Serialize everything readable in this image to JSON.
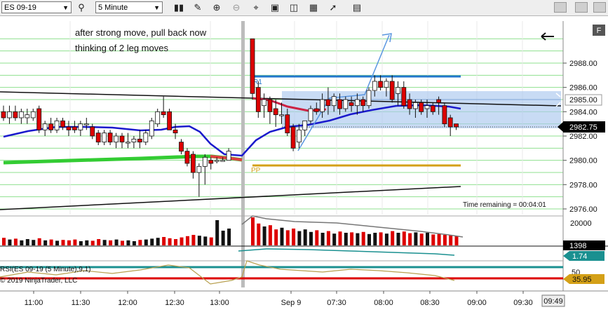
{
  "toolbar": {
    "instrument": "ES 09-19",
    "interval": "5 Minute",
    "icons": [
      "search-icon",
      "bar-style-icon",
      "pencil-icon",
      "zoom-in-icon",
      "zoom-out-icon",
      "crosshair-icon",
      "data-box-icon",
      "properties-icon",
      "strategy-icon",
      "indicators-icon",
      "template-icon"
    ]
  },
  "annotations": {
    "line1": "after strong move, pull back now",
    "line2": "thinking of 2 leg moves"
  },
  "f_button": "F",
  "time_remaining": "Time remaining = 00:04:01",
  "level_labels": {
    "r1": "R1",
    "pp": "PP"
  },
  "price_axis": {
    "ticks": [
      "2988.00",
      "2986.00",
      "2984.00",
      "2982.00",
      "2980.00",
      "2978.00",
      "2976.00"
    ],
    "current_price": "2982.75",
    "marker_price": "2985.00"
  },
  "volume_panel": {
    "tick": "20000",
    "current": "1398"
  },
  "indicator_panel": {
    "title": "RSI(ES 09-19 (5 Minute),9,1)",
    "copyright": "© 2019 NinjaTrader, LLC",
    "tick": "50",
    "value_teal": "1.74",
    "value_rsi": "35.95"
  },
  "time_axis": {
    "labels": [
      "11:00",
      "11:30",
      "12:00",
      "12:30",
      "13:00",
      "Sep 9",
      "07:30",
      "08:00",
      "08:30",
      "09:00",
      "09:30"
    ],
    "current_time": "09:49"
  },
  "chart_data": {
    "type": "candlestick",
    "instrument": "ES 09-19",
    "interval": "5 Minute",
    "y_ticks": [
      2976,
      2978,
      2980,
      2982,
      2984,
      2986,
      2988
    ],
    "ylim": [
      2975.5,
      2990
    ],
    "pivot_r1": 2987,
    "pivot_pp": 2979.5,
    "current_price": 2982.75,
    "candles": [
      {
        "o": 2984,
        "h": 2984.5,
        "l": 2983.25,
        "c": 2983.5
      },
      {
        "o": 2983.5,
        "h": 2984.5,
        "l": 2983,
        "c": 2984
      },
      {
        "o": 2984,
        "h": 2984.5,
        "l": 2983.25,
        "c": 2983.5
      },
      {
        "o": 2983.5,
        "h": 2984.25,
        "l": 2983,
        "c": 2984
      },
      {
        "o": 2983.5,
        "h": 2984.25,
        "l": 2983,
        "c": 2983.75
      },
      {
        "o": 2983.5,
        "h": 2984.25,
        "l": 2983.25,
        "c": 2984
      },
      {
        "o": 2984.25,
        "h": 2984.5,
        "l": 2982.25,
        "c": 2982.5
      },
      {
        "o": 2982.5,
        "h": 2983.25,
        "l": 2982,
        "c": 2983
      },
      {
        "o": 2983,
        "h": 2983.5,
        "l": 2982.25,
        "c": 2982.5
      },
      {
        "o": 2982.5,
        "h": 2983.5,
        "l": 2982.25,
        "c": 2983.25
      },
      {
        "o": 2983.25,
        "h": 2983.5,
        "l": 2982.5,
        "c": 2982.75
      },
      {
        "o": 2982.75,
        "h": 2983.25,
        "l": 2982,
        "c": 2982.5
      },
      {
        "o": 2982.75,
        "h": 2983.25,
        "l": 2982.25,
        "c": 2982.5
      },
      {
        "o": 2982.5,
        "h": 2983.25,
        "l": 2982,
        "c": 2983
      },
      {
        "o": 2983,
        "h": 2983.5,
        "l": 2982.5,
        "c": 2983
      },
      {
        "o": 2982.75,
        "h": 2983,
        "l": 2981.75,
        "c": 2982
      },
      {
        "o": 2982.25,
        "h": 2982.5,
        "l": 2981.25,
        "c": 2981.5
      },
      {
        "o": 2981.5,
        "h": 2982.5,
        "l": 2981.25,
        "c": 2982.25
      },
      {
        "o": 2982.25,
        "h": 2982.5,
        "l": 2981.25,
        "c": 2981.5
      },
      {
        "o": 2981.5,
        "h": 2982.25,
        "l": 2981,
        "c": 2982
      },
      {
        "o": 2982,
        "h": 2982.25,
        "l": 2981,
        "c": 2981.5
      },
      {
        "o": 2981.5,
        "h": 2982.25,
        "l": 2981,
        "c": 2981.5
      },
      {
        "o": 2981.5,
        "h": 2982,
        "l": 2981,
        "c": 2981.75
      },
      {
        "o": 2981.75,
        "h": 2982.5,
        "l": 2981,
        "c": 2981.5
      },
      {
        "o": 2981.5,
        "h": 2982.5,
        "l": 2981.25,
        "c": 2982.25
      },
      {
        "o": 2982,
        "h": 2983.5,
        "l": 2981.75,
        "c": 2983.25
      },
      {
        "o": 2983,
        "h": 2984.25,
        "l": 2982.75,
        "c": 2984
      },
      {
        "o": 2984,
        "h": 2985.25,
        "l": 2983.5,
        "c": 2983.75
      },
      {
        "o": 2984,
        "h": 2984.25,
        "l": 2982.5,
        "c": 2982.5
      },
      {
        "o": 2982.5,
        "h": 2983,
        "l": 2981.75,
        "c": 2982.25
      },
      {
        "o": 2981.5,
        "h": 2981.75,
        "l": 2980.5,
        "c": 2980.75
      },
      {
        "o": 2980.75,
        "h": 2981,
        "l": 2979.5,
        "c": 2979.75
      },
      {
        "o": 2980.5,
        "h": 2980.75,
        "l": 2978.5,
        "c": 2979
      },
      {
        "o": 2979,
        "h": 2979.75,
        "l": 2977,
        "c": 2979.5
      },
      {
        "o": 2979.5,
        "h": 2980.5,
        "l": 2978,
        "c": 2980.25
      },
      {
        "o": 2980,
        "h": 2980.25,
        "l": 2979.25,
        "c": 2979.75
      },
      {
        "o": 2980,
        "h": 2980.25,
        "l": 2979.75,
        "c": 2980
      },
      {
        "o": 2980,
        "h": 2980.25,
        "l": 2980,
        "c": 2980
      },
      {
        "o": 2980,
        "h": 2981,
        "l": 2980,
        "c": 2980.75
      },
      {
        "o": 2990,
        "h": 2990,
        "l": 2985,
        "c": 2985.5
      },
      {
        "o": 2986,
        "h": 2986.5,
        "l": 2983.5,
        "c": 2984
      },
      {
        "o": 2984.5,
        "h": 2985.5,
        "l": 2983.5,
        "c": 2985
      },
      {
        "o": 2985,
        "h": 2985.25,
        "l": 2983,
        "c": 2984
      },
      {
        "o": 2984.25,
        "h": 2985,
        "l": 2982.75,
        "c": 2983.75
      },
      {
        "o": 2983.75,
        "h": 2984.75,
        "l": 2983,
        "c": 2983.75
      },
      {
        "o": 2983.75,
        "h": 2984.25,
        "l": 2982,
        "c": 2982.25
      },
      {
        "o": 2982.75,
        "h": 2983,
        "l": 2980.75,
        "c": 2981
      },
      {
        "o": 2981.5,
        "h": 2983,
        "l": 2981,
        "c": 2982.5
      },
      {
        "o": 2982.5,
        "h": 2983.25,
        "l": 2982,
        "c": 2983.25
      },
      {
        "o": 2983.25,
        "h": 2984.5,
        "l": 2983,
        "c": 2984.25
      },
      {
        "o": 2984.25,
        "h": 2984.75,
        "l": 2983.75,
        "c": 2984
      },
      {
        "o": 2984,
        "h": 2985.5,
        "l": 2983.5,
        "c": 2985
      },
      {
        "o": 2985,
        "h": 2986,
        "l": 2983.75,
        "c": 2984.5
      },
      {
        "o": 2984.5,
        "h": 2985.5,
        "l": 2984,
        "c": 2985.25
      },
      {
        "o": 2985,
        "h": 2985.5,
        "l": 2983.75,
        "c": 2984.25
      },
      {
        "o": 2984.25,
        "h": 2985.25,
        "l": 2984,
        "c": 2985
      },
      {
        "o": 2984.75,
        "h": 2985.25,
        "l": 2984,
        "c": 2984.5
      },
      {
        "o": 2984.5,
        "h": 2985.5,
        "l": 2983.75,
        "c": 2985
      },
      {
        "o": 2985,
        "h": 2985.25,
        "l": 2984,
        "c": 2984.5
      },
      {
        "o": 2984.5,
        "h": 2986,
        "l": 2984.25,
        "c": 2985.75
      },
      {
        "o": 2985.75,
        "h": 2987,
        "l": 2985.25,
        "c": 2986.5
      },
      {
        "o": 2986.5,
        "h": 2987,
        "l": 2985.75,
        "c": 2986
      },
      {
        "o": 2986,
        "h": 2986.75,
        "l": 2985.25,
        "c": 2986.5
      },
      {
        "o": 2986.5,
        "h": 2987,
        "l": 2984.75,
        "c": 2985
      },
      {
        "o": 2985.5,
        "h": 2986.5,
        "l": 2984.5,
        "c": 2986
      },
      {
        "o": 2986,
        "h": 2986.5,
        "l": 2984.25,
        "c": 2984.5
      },
      {
        "o": 2985,
        "h": 2985.5,
        "l": 2983.75,
        "c": 2984.25
      },
      {
        "o": 2984.25,
        "h": 2985,
        "l": 2983.5,
        "c": 2984.75
      },
      {
        "o": 2984.75,
        "h": 2985,
        "l": 2983.75,
        "c": 2984
      },
      {
        "o": 2984.25,
        "h": 2985,
        "l": 2983.5,
        "c": 2984.5
      },
      {
        "o": 2984.5,
        "h": 2984.75,
        "l": 2983.75,
        "c": 2984
      },
      {
        "o": 2985,
        "h": 2985.25,
        "l": 2983.75,
        "c": 2984.75
      },
      {
        "o": 2984.5,
        "h": 2984.75,
        "l": 2982.75,
        "c": 2983
      },
      {
        "o": 2983.5,
        "h": 2983.75,
        "l": 2982,
        "c": 2982.75
      },
      {
        "o": 2983,
        "h": 2983,
        "l": 2982.5,
        "c": 2982.75
      }
    ],
    "volume": [
      18,
      14,
      16,
      12,
      15,
      13,
      17,
      12,
      14,
      11,
      13,
      12,
      14,
      10,
      12,
      11,
      15,
      13,
      12,
      14,
      11,
      12,
      10,
      13,
      14,
      16,
      18,
      20,
      17,
      15,
      19,
      22,
      25,
      23,
      21,
      19,
      60,
      35,
      40,
      70,
      52,
      45,
      48,
      38,
      42,
      36,
      40,
      34,
      38,
      32,
      36,
      30,
      34,
      28,
      33,
      30,
      31,
      29,
      32,
      27,
      30,
      31,
      28,
      34,
      30,
      33,
      29,
      31,
      28,
      30,
      26,
      27,
      25,
      24,
      22
    ]
  },
  "colors": {
    "bull_candle": "#ffffff",
    "bear_candle": "#dd0000",
    "ema_blue": "#1a1acc",
    "sma_green": "#33cc33",
    "pivot_r1": "#2277cc",
    "pivot_pp": "#d4a017",
    "range_box": "#aac8ee",
    "rsi_line": "#b8a050",
    "teal_line": "#1a9090",
    "rsi_level_red": "#dd0000"
  }
}
